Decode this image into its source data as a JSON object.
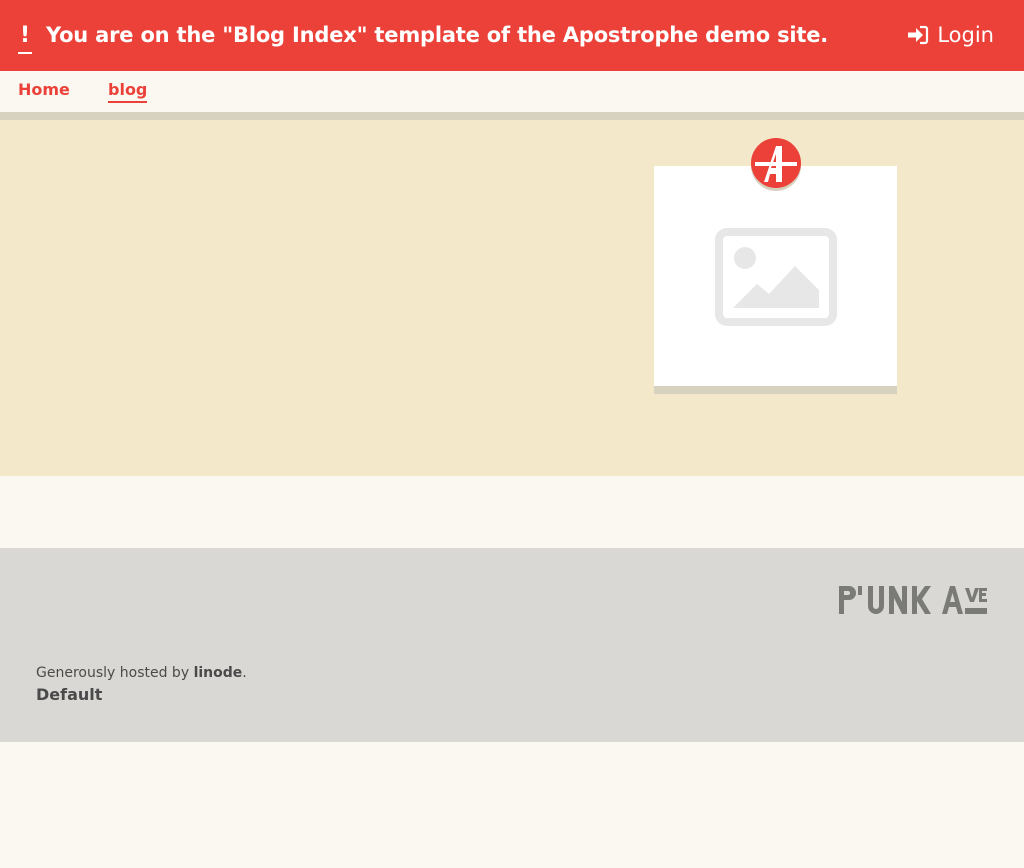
{
  "topbar": {
    "bang": "!",
    "notice": "You are on the \"Blog Index\" template of the Apostrophe demo site.",
    "login_label": "Login",
    "background": "#ec4139"
  },
  "nav": {
    "items": [
      {
        "label": "Home"
      },
      {
        "label": "blog"
      }
    ],
    "active": "blog"
  },
  "hero": {
    "logo_letter": "A",
    "placeholder_icon": "image-placeholder-icon"
  },
  "footer": {
    "hosted_prefix": "Generously hosted by",
    "hosted_by": "linode",
    "hosted_suffix": ".",
    "default_label": "Default",
    "brand": "P'UNK AVE"
  },
  "colors": {
    "accent": "#ec4139",
    "hero_bg": "#f3e8ca",
    "footer_bg": "#d9d8d4",
    "page_bg": "#fbf8f1"
  }
}
